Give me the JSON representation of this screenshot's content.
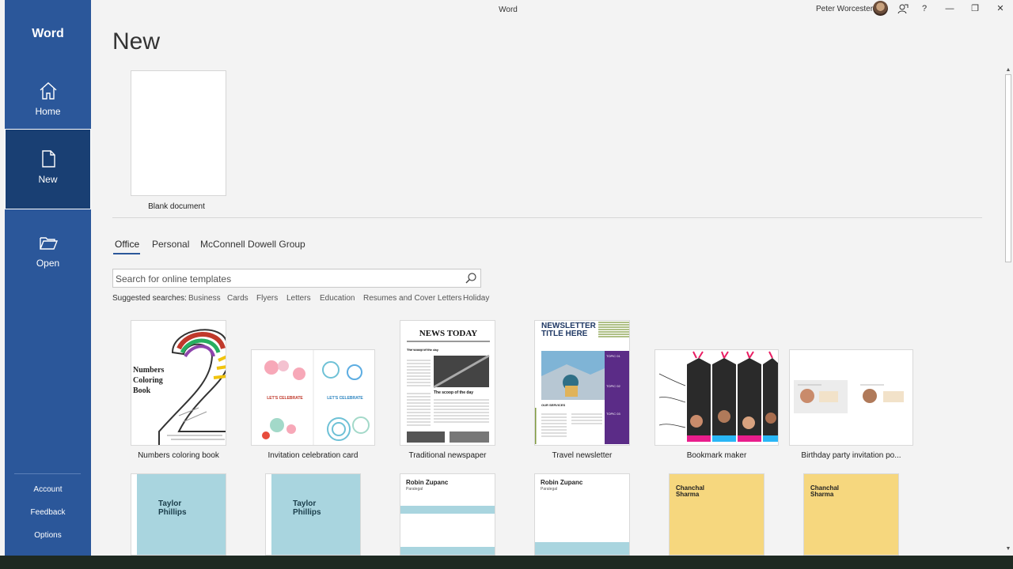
{
  "app": {
    "name": "Word",
    "window_title": "Word"
  },
  "user": {
    "name": "Peter Worcester"
  },
  "sidebar": {
    "items": [
      {
        "label": "Home",
        "icon": "home-icon"
      },
      {
        "label": "New",
        "icon": "new-document-icon"
      },
      {
        "label": "Open",
        "icon": "folder-icon"
      }
    ],
    "bottom_links": [
      "Account",
      "Feedback",
      "Options"
    ]
  },
  "main": {
    "title": "New",
    "blank_document_label": "Blank document",
    "tabs": [
      "Office",
      "Personal",
      "McConnell Dowell Group"
    ],
    "search": {
      "placeholder": "Search for online templates"
    },
    "suggested_label": "Suggested searches:",
    "suggested": [
      "Business",
      "Cards",
      "Flyers",
      "Letters",
      "Education",
      "Resumes and Cover Letters",
      "Holiday"
    ],
    "templates_row1": [
      {
        "label": "Numbers coloring book",
        "thumb_text": [
          "Numbers",
          "Coloring",
          "Book"
        ]
      },
      {
        "label": "Invitation celebration card",
        "thumb_text": [
          "LET'S CELEBRATE",
          "LET'S CELEBRATE"
        ]
      },
      {
        "label": "Traditional newspaper",
        "thumb_text": [
          "NEWS TODAY",
          "The scoop of the day",
          "The scoop of the day"
        ]
      },
      {
        "label": "Travel newsletter",
        "thumb_text": [
          "NEWSLETTER",
          "TITLE HERE",
          "TOPIC 01",
          "TOPIC 02",
          "TOPIC 03",
          "OUR SERVICES"
        ]
      },
      {
        "label": "Bookmark maker",
        "thumb_text": []
      },
      {
        "label": "Birthday party invitation po...",
        "thumb_text": []
      }
    ],
    "templates_row2": [
      {
        "name_text": [
          "Taylor",
          "Phillips"
        ]
      },
      {
        "name_text": [
          "Taylor",
          "Phillips"
        ]
      },
      {
        "name_text": [
          "Robin Zupanc",
          "Paralegal"
        ]
      },
      {
        "name_text": [
          "Robin Zupanc",
          "Paralegal"
        ]
      },
      {
        "name_text": [
          "Chanchal",
          "Sharma"
        ]
      },
      {
        "name_text": [
          "Chanchal",
          "Sharma"
        ]
      }
    ]
  },
  "colors": {
    "accent": "#2b579a",
    "accent_dark": "#193f73"
  }
}
